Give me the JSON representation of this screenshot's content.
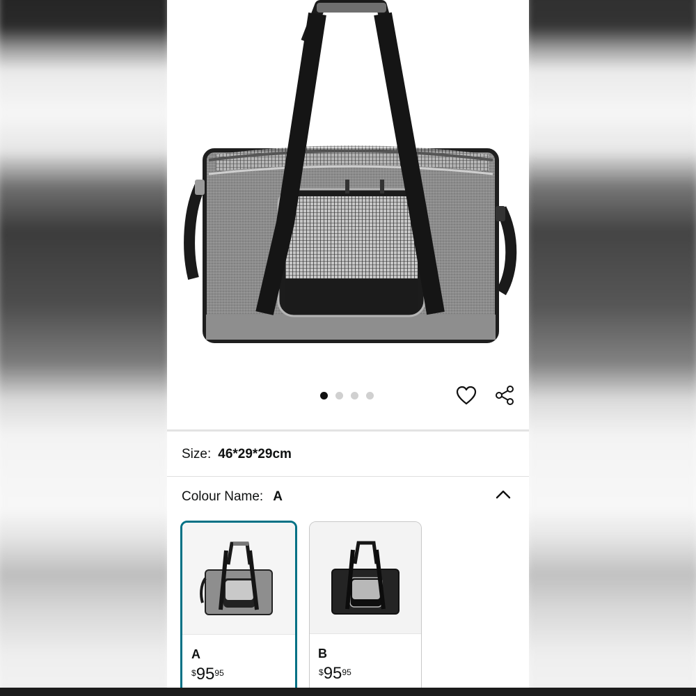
{
  "gallery": {
    "image_alt": "Grey pet carrier bag",
    "page_count": 4,
    "active_index": 0
  },
  "actions": {
    "wishlist_icon": "heart-outline-icon",
    "share_icon": "share-icon"
  },
  "size": {
    "label": "Size:",
    "value": "46*29*29cm"
  },
  "colour": {
    "label": "Colour Name:",
    "value": "A",
    "collapse_icon": "chevron-up-icon",
    "options": [
      {
        "name": "A",
        "price_symbol": "$",
        "price_whole": "95",
        "price_fraction": "95",
        "selected": true,
        "color": "#8a8a8a"
      },
      {
        "name": "B",
        "price_symbol": "$",
        "price_whole": "95",
        "price_fraction": "95",
        "selected": false,
        "color": "#222222"
      }
    ]
  },
  "colors": {
    "selected_border": "#007185",
    "text": "#0f1111"
  }
}
